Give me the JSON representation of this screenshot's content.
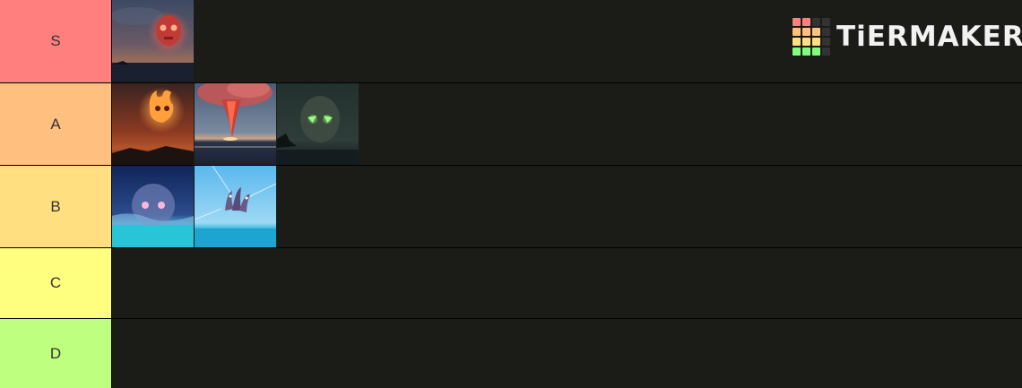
{
  "tiers": [
    {
      "label": "S",
      "color": "#ff7f7f"
    },
    {
      "label": "A",
      "color": "#ffbf7f"
    },
    {
      "label": "B",
      "color": "#ffdf7f"
    },
    {
      "label": "C",
      "color": "#ffff7f"
    },
    {
      "label": "D",
      "color": "#bfff7f"
    }
  ],
  "items": {
    "S": [
      "red-skull-cloud-image"
    ],
    "A": [
      "flame-skull-image",
      "red-tornado-image",
      "green-skull-image"
    ],
    "B": [
      "blue-skull-storm-image",
      "kraken-tentacles-image"
    ],
    "C": [],
    "D": []
  },
  "logo": {
    "text": "TiERMAKER",
    "grid_colors": [
      "#ff7f7f",
      "#ff7f7f",
      "#333333",
      "#333333",
      "#ffbf7f",
      "#ffbf7f",
      "#ffbf7f",
      "#333333",
      "#ffdf7f",
      "#ffdf7f",
      "#ffdf7f",
      "#333333",
      "#7fff7f",
      "#7fff7f",
      "#7fff7f",
      "#333333"
    ]
  }
}
